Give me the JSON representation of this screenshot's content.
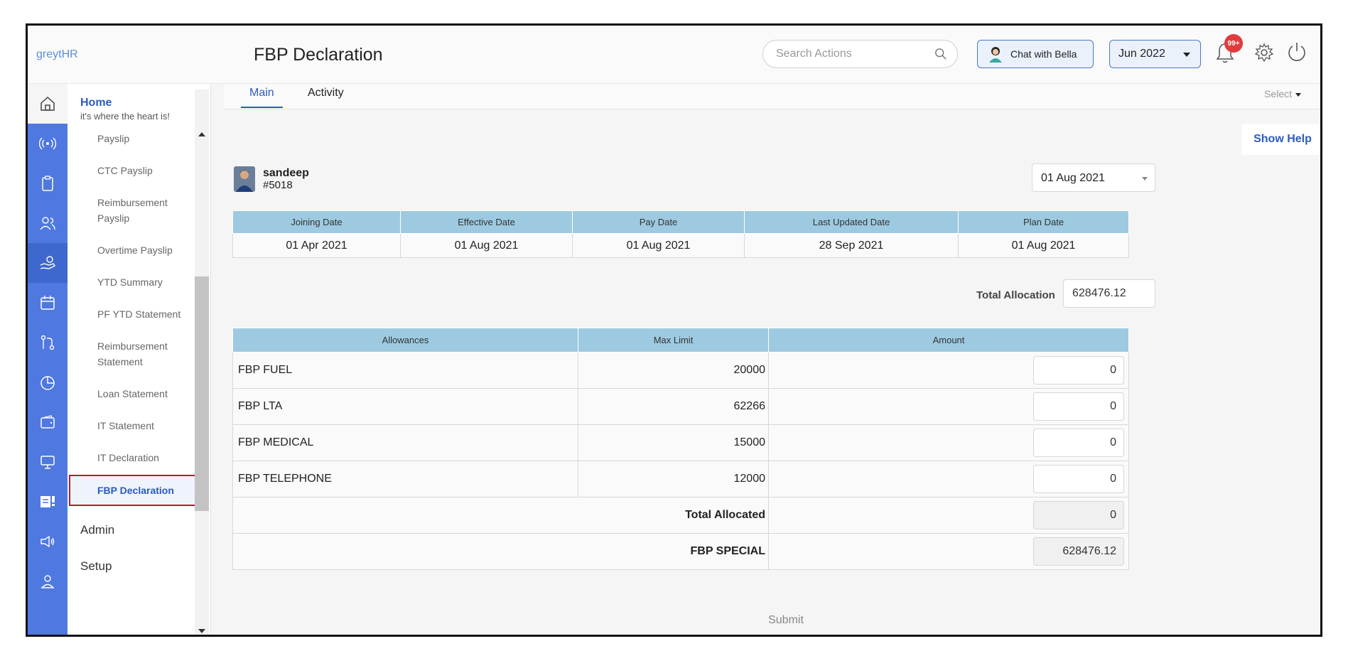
{
  "app": {
    "brand": "greytHR",
    "page_title": "FBP Declaration"
  },
  "header": {
    "search_placeholder": "Search Actions",
    "chat_label": "Chat with Bella",
    "month": "Jun 2022",
    "notification_badge": "99+"
  },
  "sidebar": {
    "home_title": "Home",
    "home_sub": "it's where the heart is!",
    "items": [
      "Payslip",
      "CTC Payslip",
      "Reimbursement Payslip",
      "Overtime Payslip",
      "YTD Summary",
      "PF YTD Statement",
      "Reimbursement Statement",
      "Loan Statement",
      "IT Statement",
      "IT Declaration",
      "FBP Declaration"
    ],
    "groups": [
      "Admin",
      "Setup"
    ]
  },
  "tabs": {
    "main": "Main",
    "activity": "Activity",
    "select": "Select"
  },
  "help": {
    "label": "Show Help"
  },
  "employee": {
    "name": "sandeep",
    "id": "#5018",
    "plan_date_select": "01 Aug 2021"
  },
  "dates_table": {
    "headers": [
      "Joining Date",
      "Effective Date",
      "Pay Date",
      "Last Updated Date",
      "Plan Date"
    ],
    "values": [
      "01 Apr 2021",
      "01 Aug 2021",
      "01 Aug 2021",
      "28 Sep 2021",
      "01 Aug 2021"
    ]
  },
  "total_allocation": {
    "label": "Total Allocation",
    "value": "628476.12"
  },
  "allowances": {
    "headers": [
      "Allowances",
      "Max Limit",
      "Amount"
    ],
    "rows": [
      {
        "name": "FBP FUEL",
        "limit": "20000",
        "amount": "0"
      },
      {
        "name": "FBP LTA",
        "limit": "62266",
        "amount": "0"
      },
      {
        "name": "FBP MEDICAL",
        "limit": "15000",
        "amount": "0"
      },
      {
        "name": "FBP TELEPHONE",
        "limit": "12000",
        "amount": "0"
      }
    ],
    "total_allocated_label": "Total Allocated",
    "total_allocated_value": "0",
    "special_label": "FBP SPECIAL",
    "special_value": "628476.12"
  },
  "submit_label": "Submit",
  "colors": {
    "accent": "#4f78e0",
    "table_header": "#9dcae0",
    "active_border": "#c0172d"
  }
}
